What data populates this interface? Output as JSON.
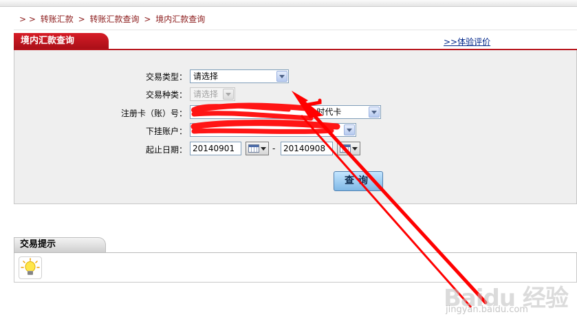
{
  "breadcrumb": {
    "prefix": "> >",
    "items": [
      "转账汇款",
      "转账汇款查询",
      "境内汇款查询"
    ],
    "separator": ">"
  },
  "panel": {
    "title": "境内汇款查询",
    "eval_link": ">>体验评价"
  },
  "form": {
    "trade_type": {
      "label": "交易类型：",
      "value": "请选择"
    },
    "trade_kind": {
      "label": "交易种类：",
      "value": "请选择"
    },
    "card": {
      "label": "注册卡（账）号：",
      "value_visible_suffix": "e时代卡"
    },
    "sub_account": {
      "label": "下挂账户："
    },
    "date": {
      "label": "起止日期：",
      "start": "20140901",
      "end": "20140908",
      "dash": "-"
    },
    "query_button": "查询"
  },
  "tips": {
    "title": "交易提示"
  },
  "watermark": {
    "logo": "Baidu 经验",
    "url": "jingyan.baidu.com"
  },
  "colors": {
    "brand_red": "#c8141e",
    "breadcrumb": "#8b1a1a",
    "link_blue": "#00268a",
    "annotation_red": "#ff0000"
  }
}
